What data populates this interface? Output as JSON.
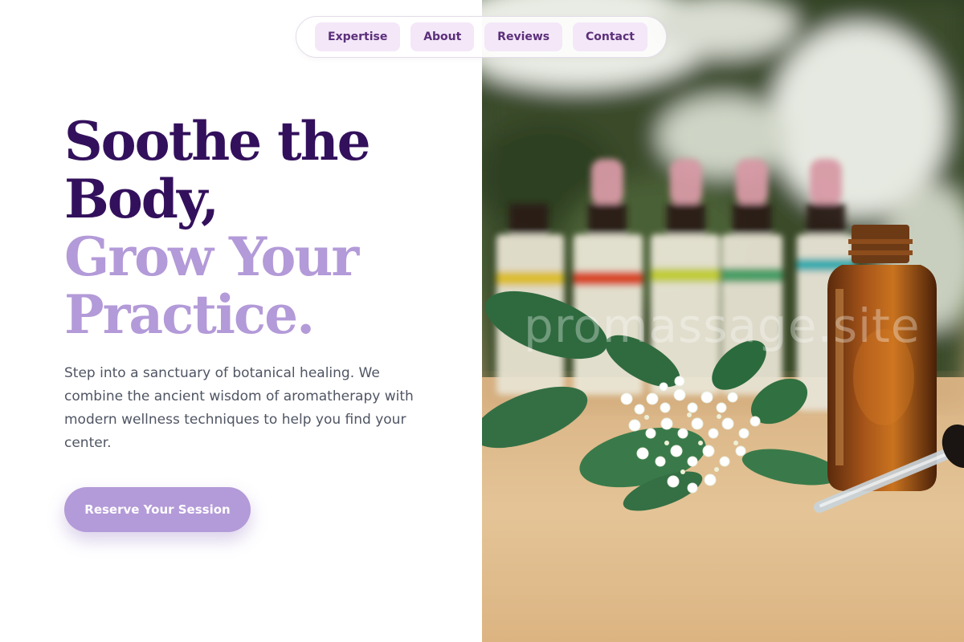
{
  "nav": {
    "items": [
      {
        "label": "Expertise"
      },
      {
        "label": "About"
      },
      {
        "label": "Reviews"
      },
      {
        "label": "Contact"
      }
    ]
  },
  "hero": {
    "title_line1": "Soothe the",
    "title_line2": "Body,",
    "title_line3": "Grow Your",
    "title_line4": "Practice.",
    "description": "Step into a sanctuary of botanical healing. We combine the ancient wisdom of aromatherapy with modern wellness techniques to help you find your center.",
    "cta_label": "Reserve Your Session"
  },
  "image": {
    "watermark": "promassage.site",
    "alt": "Essential oil bottles with white flowers and green leaves on a wooden table"
  },
  "colors": {
    "title_dark": "#33105c",
    "title_light": "#b39ad8",
    "accent": "#b39ad8",
    "nav_bg": "#f3e7f8",
    "nav_text": "#5b2f7a",
    "body_text": "#4f5563"
  }
}
